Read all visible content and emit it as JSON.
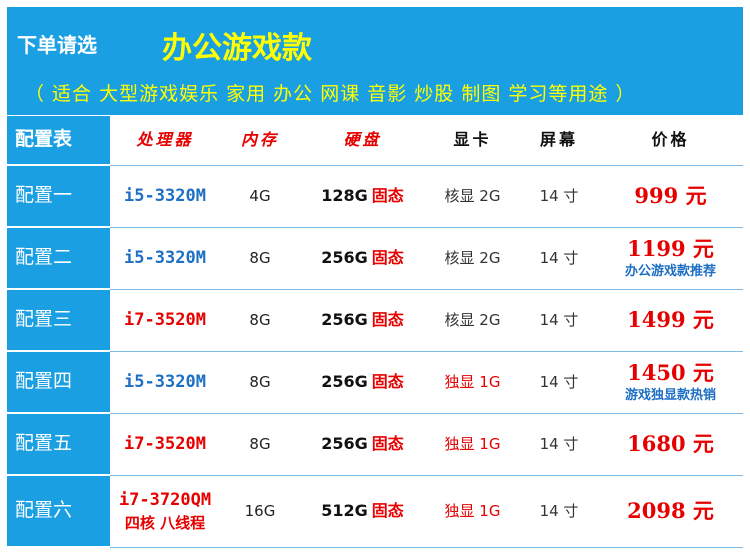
{
  "banner": {
    "order_text": "下单请选",
    "title": "办公游戏款",
    "uses": "（ 适合 大型游戏娱乐 家用 办公 网课 音影 炒股 制图 学习等用途 ）"
  },
  "colors": {
    "banner_bg": "#1a9fe2",
    "accent_yellow": "#ffff00",
    "price_red": "#e60000",
    "cpu_blue": "#1d6fc4"
  },
  "table": {
    "headers": {
      "label": "配置表",
      "cpu": "处理器",
      "memory": "内存",
      "disk": "硬盘",
      "gpu": "显卡",
      "screen": "屏幕",
      "price": "价格"
    },
    "rows": [
      {
        "label": "配置一",
        "cpu": "i5-3320M",
        "cpu_color": "blue",
        "cpu_sub": "",
        "memory": "4G",
        "disk_capacity": "128G",
        "disk_type": "固态",
        "gpu": "核显 2G",
        "gpu_color": "gray",
        "screen": "14 寸",
        "price": "999 元",
        "note": ""
      },
      {
        "label": "配置二",
        "cpu": "i5-3320M",
        "cpu_color": "blue",
        "cpu_sub": "",
        "memory": "8G",
        "disk_capacity": "256G",
        "disk_type": "固态",
        "gpu": "核显 2G",
        "gpu_color": "gray",
        "screen": "14 寸",
        "price": "1199 元",
        "note": "办公游戏款推荐"
      },
      {
        "label": "配置三",
        "cpu": "i7-3520M",
        "cpu_color": "red",
        "cpu_sub": "",
        "memory": "8G",
        "disk_capacity": "256G",
        "disk_type": "固态",
        "gpu": "核显 2G",
        "gpu_color": "gray",
        "screen": "14 寸",
        "price": "1499 元",
        "note": ""
      },
      {
        "label": "配置四",
        "cpu": "i5-3320M",
        "cpu_color": "blue",
        "cpu_sub": "",
        "memory": "8G",
        "disk_capacity": "256G",
        "disk_type": "固态",
        "gpu": "独显 1G",
        "gpu_color": "red",
        "screen": "14 寸",
        "price": "1450 元",
        "note": "游戏独显款热销"
      },
      {
        "label": "配置五",
        "cpu": "i7-3520M",
        "cpu_color": "red",
        "cpu_sub": "",
        "memory": "8G",
        "disk_capacity": "256G",
        "disk_type": "固态",
        "gpu": "独显 1G",
        "gpu_color": "red",
        "screen": "14 寸",
        "price": "1680 元",
        "note": ""
      },
      {
        "label": "配置六",
        "cpu": "i7-3720QM",
        "cpu_color": "red",
        "cpu_sub": "四核 八线程",
        "memory": "16G",
        "disk_capacity": "512G",
        "disk_type": "固态",
        "gpu": "独显 1G",
        "gpu_color": "red",
        "screen": "14 寸",
        "price": "2098 元",
        "note": ""
      }
    ]
  }
}
